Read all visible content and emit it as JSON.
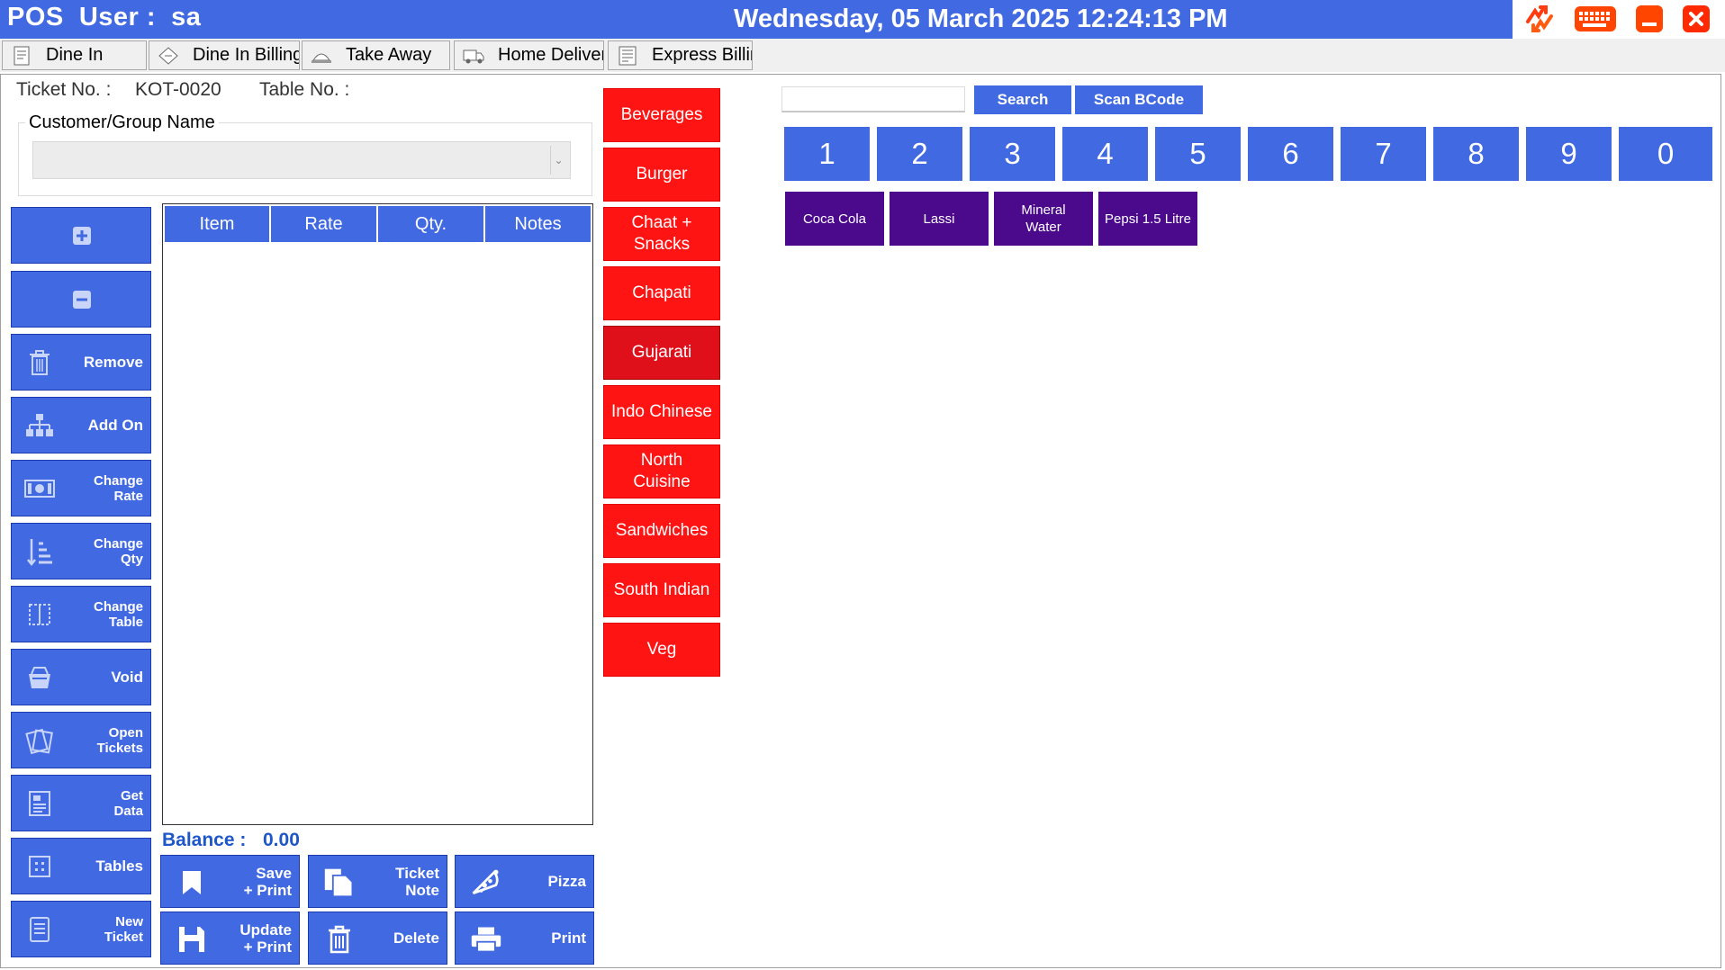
{
  "header": {
    "pos_user": "POS  User :  sa",
    "datetime": "Wednesday, 05 March 2025 12:24:13 PM",
    "controls": [
      {
        "name": "sync-icon",
        "color": "#ff3b10"
      },
      {
        "name": "keyboard-icon",
        "color": "#ff4500"
      },
      {
        "name": "minimize-icon",
        "color": "#ff4500"
      },
      {
        "name": "close-icon",
        "color": "#ff2a00"
      }
    ]
  },
  "tabs": [
    {
      "label": "Dine In",
      "icon": "document-icon"
    },
    {
      "label": "Dine In Billing",
      "icon": "ticket-icon"
    },
    {
      "label": "Take Away",
      "icon": "food-tray-icon"
    },
    {
      "label": "Home Delivery",
      "icon": "delivery-truck-icon"
    },
    {
      "label": "Express Billing",
      "icon": "express-bill-icon"
    }
  ],
  "ticket": {
    "ticket_no_label": "Ticket No. :",
    "ticket_no_value": "KOT-0020",
    "table_no_label": "Table No. :",
    "customer_label": "Customer/Group Name",
    "customer_value": ""
  },
  "side_buttons": [
    {
      "label": "",
      "icon": "plus-icon"
    },
    {
      "label": "",
      "icon": "minus-icon"
    },
    {
      "label": "Remove",
      "icon": "trash-icon"
    },
    {
      "label": "Add On",
      "icon": "hierarchy-icon"
    },
    {
      "label": "Change\nRate",
      "icon": "money-icon"
    },
    {
      "label": "Change\nQty",
      "icon": "sort-icon"
    },
    {
      "label": "Change\nTable",
      "icon": "table-icon"
    },
    {
      "label": "Void",
      "icon": "basket-icon"
    },
    {
      "label": "Open\nTickets",
      "icon": "tickets-icon"
    },
    {
      "label": "Get\nData",
      "icon": "data-icon"
    },
    {
      "label": "Tables",
      "icon": "tables-icon"
    },
    {
      "label": "New\nTicket",
      "icon": "new-ticket-icon"
    }
  ],
  "grid": {
    "columns": [
      "Item",
      "Rate",
      "Qty.",
      "Notes"
    ],
    "rows": []
  },
  "balance": {
    "label": "Balance :",
    "value": "0.00"
  },
  "actions": [
    {
      "label": "Save\n+ Print",
      "icon": "bookmark-icon"
    },
    {
      "label": "Ticket\nNote",
      "icon": "copy-icon"
    },
    {
      "label": "Pizza",
      "icon": "pizza-icon"
    },
    {
      "label": "Update\n+ Print",
      "icon": "save-icon"
    },
    {
      "label": "Delete",
      "icon": "trash-icon"
    },
    {
      "label": "Print",
      "icon": "printer-icon"
    }
  ],
  "categories": [
    {
      "label": "Beverages",
      "selected": false
    },
    {
      "label": "Burger",
      "selected": false
    },
    {
      "label": "Chaat +\nSnacks",
      "selected": false
    },
    {
      "label": "Chapati",
      "selected": false
    },
    {
      "label": "Gujarati",
      "selected": true
    },
    {
      "label": "Indo Chinese",
      "selected": false
    },
    {
      "label": "North\nCuisine",
      "selected": false
    },
    {
      "label": "Sandwiches",
      "selected": false
    },
    {
      "label": "South Indian",
      "selected": false
    },
    {
      "label": "Veg",
      "selected": false
    }
  ],
  "search": {
    "value": "",
    "placeholder": "",
    "search_label": "Search",
    "scan_label": "Scan BCode"
  },
  "numpad": [
    "1",
    "2",
    "3",
    "4",
    "5",
    "6",
    "7",
    "8",
    "9",
    "0"
  ],
  "items": [
    "Coca Cola",
    "Lassi",
    "Mineral\nWater",
    "Pepsi 1.5 Litre"
  ],
  "colors": {
    "accent": "#4169e1",
    "category": "#ff1414",
    "item": "#4b0a8c",
    "balance": "#1e57c8"
  }
}
